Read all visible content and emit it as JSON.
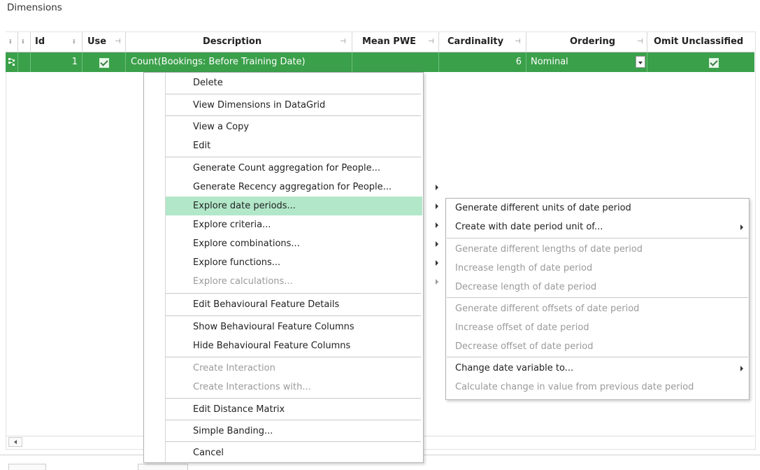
{
  "title": "Dimensions",
  "columns": {
    "id": "Id",
    "use": "Use",
    "description": "Description",
    "mean_pwe": "Mean PWE",
    "cardinality": "Cardinality",
    "ordering": "Ordering",
    "omit_unclassified": "Omit Unclassified"
  },
  "icons": {
    "pin": "pin-icon",
    "pin_glyph": "ᵻ",
    "pin_side_glyph": "⊣"
  },
  "row": {
    "id": "1",
    "use": true,
    "description": "Count(Bookings: Before Training Date)",
    "mean_pwe": "",
    "cardinality": "6",
    "ordering": "Nominal",
    "omit_unclassified": true
  },
  "colors": {
    "row_selected": "#3aa04a",
    "menu_highlight": "#b2e8c9"
  },
  "context_menu": {
    "items": [
      {
        "label": "Delete",
        "enabled": true
      },
      {
        "label": "View Dimensions in DataGrid",
        "enabled": true
      },
      {
        "label": "View a Copy",
        "enabled": true
      },
      {
        "label": "Edit",
        "enabled": true
      },
      {
        "label": "Generate Count aggregation for People...",
        "enabled": true
      },
      {
        "label": "Generate Recency aggregation for People...",
        "enabled": true,
        "submenu": true
      },
      {
        "label": "Explore date periods...",
        "enabled": true,
        "submenu": true,
        "highlighted": true
      },
      {
        "label": "Explore criteria...",
        "enabled": true,
        "submenu": true
      },
      {
        "label": "Explore combinations...",
        "enabled": true,
        "submenu": true
      },
      {
        "label": "Explore functions...",
        "enabled": true,
        "submenu": true
      },
      {
        "label": "Explore calculations...",
        "enabled": false,
        "submenu": true
      },
      {
        "label": "Edit Behavioural Feature Details",
        "enabled": true
      },
      {
        "label": "Show Behavioural Feature Columns",
        "enabled": true
      },
      {
        "label": "Hide Behavioural Feature Columns",
        "enabled": true
      },
      {
        "label": "Create Interaction",
        "enabled": false
      },
      {
        "label": "Create Interactions with...",
        "enabled": false
      },
      {
        "label": "Edit Distance Matrix",
        "enabled": true
      },
      {
        "label": "Simple Banding...",
        "enabled": true
      },
      {
        "label": "Cancel",
        "enabled": true
      }
    ]
  },
  "submenu": {
    "items": [
      {
        "label": "Generate different units of date period",
        "enabled": true
      },
      {
        "label": "Create with date period unit of...",
        "enabled": true,
        "submenu": true
      },
      {
        "label": "Generate different lengths of date period",
        "enabled": false
      },
      {
        "label": "Increase length of date period",
        "enabled": false
      },
      {
        "label": "Decrease length of date period",
        "enabled": false
      },
      {
        "label": "Generate different offsets of date period",
        "enabled": false
      },
      {
        "label": "Increase offset of date period",
        "enabled": false
      },
      {
        "label": "Decrease offset of date period",
        "enabled": false
      },
      {
        "label": "Change date variable to...",
        "enabled": true,
        "submenu": true
      },
      {
        "label": "Calculate change in value from previous date period",
        "enabled": false
      }
    ]
  }
}
